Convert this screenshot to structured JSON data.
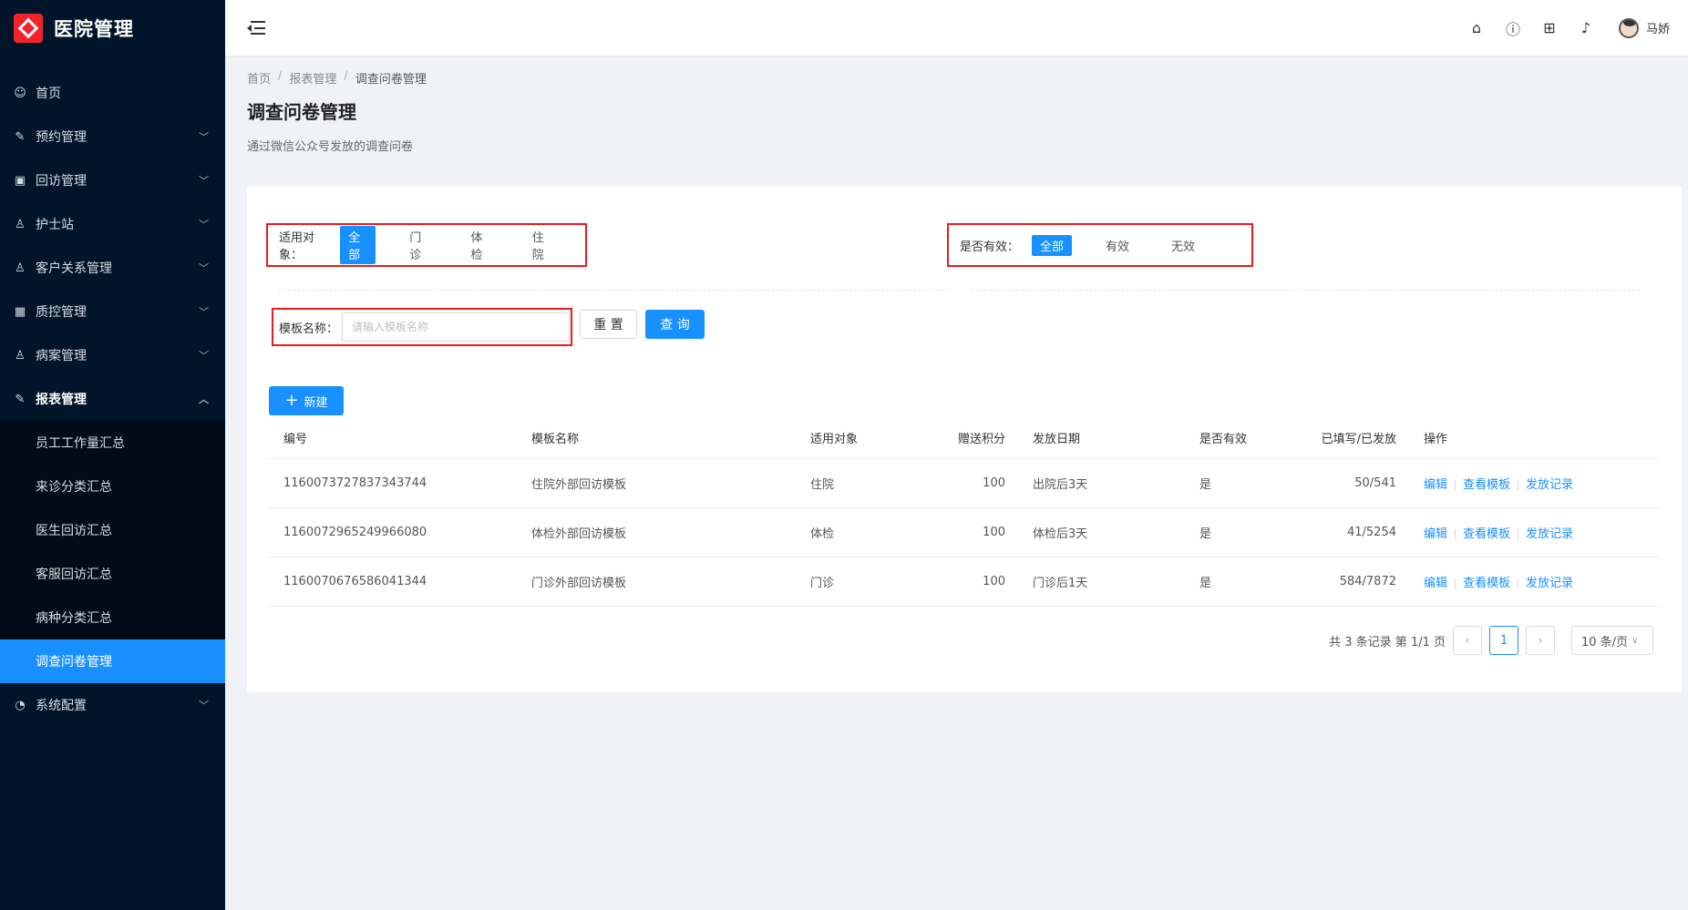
{
  "app": {
    "title": "医院管理",
    "user": "马娇"
  },
  "sidebar": {
    "items": [
      {
        "label": "首页",
        "icon": "dashboard-icon",
        "glyph": "☺",
        "has_children": false
      },
      {
        "label": "预约管理",
        "icon": "edit-icon",
        "glyph": "✎",
        "has_children": true
      },
      {
        "label": "回访管理",
        "icon": "lock-icon",
        "glyph": "▣",
        "has_children": true
      },
      {
        "label": "护士站",
        "icon": "user-icon",
        "glyph": "♙",
        "has_children": true
      },
      {
        "label": "客户关系管理",
        "icon": "user-icon",
        "glyph": "♙",
        "has_children": true
      },
      {
        "label": "质控管理",
        "icon": "table-icon",
        "glyph": "▦",
        "has_children": true
      },
      {
        "label": "病案管理",
        "icon": "user-icon",
        "glyph": "♙",
        "has_children": true
      },
      {
        "label": "报表管理",
        "icon": "edit-icon",
        "glyph": "✎",
        "has_children": true,
        "open": true
      },
      {
        "label": "系统配置",
        "icon": "gauge-icon",
        "glyph": "◔",
        "has_children": true
      }
    ],
    "report_children": [
      {
        "label": "员工工作量汇总"
      },
      {
        "label": "来诊分类汇总"
      },
      {
        "label": "医生回访汇总"
      },
      {
        "label": "客服回访汇总"
      },
      {
        "label": "病种分类汇总"
      },
      {
        "label": "调查问卷管理",
        "active": true
      }
    ]
  },
  "breadcrumb": [
    "首页",
    "报表管理",
    "调查问卷管理"
  ],
  "page": {
    "title": "调查问卷管理",
    "description": "通过微信公众号发放的调查问卷"
  },
  "filters": {
    "target": {
      "label": "适用对象：",
      "options": [
        "全部",
        "门诊",
        "体检",
        "住院"
      ],
      "selected": "全部"
    },
    "valid": {
      "label": "是否有效：",
      "options": [
        "全部",
        "有效",
        "无效"
      ],
      "selected": "全部"
    },
    "name": {
      "label": "模板名称：",
      "placeholder": "请输入模板名称",
      "value": ""
    },
    "reset_label": "重 置",
    "query_label": "查 询"
  },
  "new_button": {
    "label": "新建"
  },
  "table": {
    "columns": [
      "编号",
      "模板名称",
      "适用对象",
      "赠送积分",
      "发放日期",
      "是否有效",
      "已填写/已发放",
      "操作"
    ],
    "rows": [
      {
        "id": "1160073727837343744",
        "name": "住院外部回访模板",
        "target": "住院",
        "points": "100",
        "date": "出院后3天",
        "valid": "是",
        "ratio": "50/541"
      },
      {
        "id": "1160072965249966080",
        "name": "体检外部回访模板",
        "target": "体检",
        "points": "100",
        "date": "体检后3天",
        "valid": "是",
        "ratio": "41/5254"
      },
      {
        "id": "1160070676586041344",
        "name": "门诊外部回访模板",
        "target": "门诊",
        "points": "100",
        "date": "门诊后1天",
        "valid": "是",
        "ratio": "584/7872"
      }
    ],
    "actions": [
      "编辑",
      "查看模板",
      "发放记录"
    ]
  },
  "pagination": {
    "summary": "共 3 条记录 第 1/1 页",
    "current": "1",
    "page_size": "10 条/页"
  },
  "colors": {
    "primary": "#1890ff",
    "sidebar": "#001529",
    "highlight_border": "#e81c1c"
  }
}
